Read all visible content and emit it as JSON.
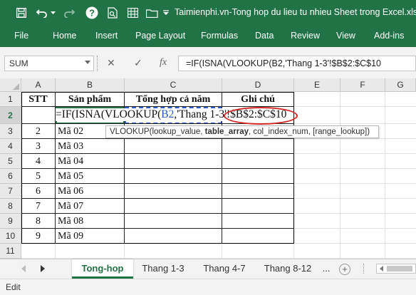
{
  "title_bar": {
    "title": "Taimienphi.vn-Tong hop du lieu tu nhieu Sheet trong Excel.xls",
    "icons": [
      "save-icon",
      "undo-icon",
      "undo-dropdown-icon",
      "redo-icon",
      "help-icon",
      "print-preview-icon",
      "table-icon",
      "folder-icon",
      "customize-qat-icon"
    ]
  },
  "ribbon": {
    "tabs": [
      "File",
      "Home",
      "Insert",
      "Page Layout",
      "Formulas",
      "Data",
      "Review",
      "View",
      "Add-ins"
    ]
  },
  "formula_bar": {
    "name_box": "SUM",
    "cancel_glyph": "✕",
    "enter_glyph": "✓",
    "fx_glyph": "fx",
    "formula": "=IF(ISNA(VLOOKUP(B2,'Thang 1-3'!$B$2:$C$10"
  },
  "grid": {
    "columns": [
      "A",
      "B",
      "C",
      "D",
      "E",
      "F",
      "G"
    ],
    "rows": [
      "1",
      "2",
      "3",
      "4",
      "5",
      "6",
      "7",
      "8",
      "9",
      "10",
      "11"
    ],
    "headers": [
      "STT",
      "Sản phẩm",
      "Tổng hợp cả năm",
      "Ghi chú"
    ],
    "data": [
      [
        "2",
        "Mã 02"
      ],
      [
        "3",
        "Mã 03"
      ],
      [
        "4",
        "Mã 04"
      ],
      [
        "5",
        "Mã 05"
      ],
      [
        "6",
        "Mã 06"
      ],
      [
        "7",
        "Mã 07"
      ],
      [
        "8",
        "Mã 08"
      ],
      [
        "9",
        "Mã 09"
      ]
    ],
    "editing_cell": {
      "part1": "=IF(ISNA(VLOOKUP(",
      "ref": "B2",
      "part2": ",'Thang 1-3'",
      "range": "!$B$2:$C$10"
    },
    "tooltip": {
      "fn": "VLOOKUP(",
      "arg1": "lookup_value",
      "sep1": ", ",
      "arg2": "table_array",
      "rest": ", col_index_num, [range_lookup])"
    }
  },
  "sheets": {
    "tabs": [
      "Tong-hop",
      "Thang 1-3",
      "Thang 4-7",
      "Thang 8-12"
    ],
    "active": "Tong-hop",
    "more": "...",
    "add": "+"
  },
  "status": {
    "mode": "Edit"
  },
  "colors": {
    "accent": "#217346",
    "highlight": "#d32525",
    "reference": "#2b5bd1"
  }
}
